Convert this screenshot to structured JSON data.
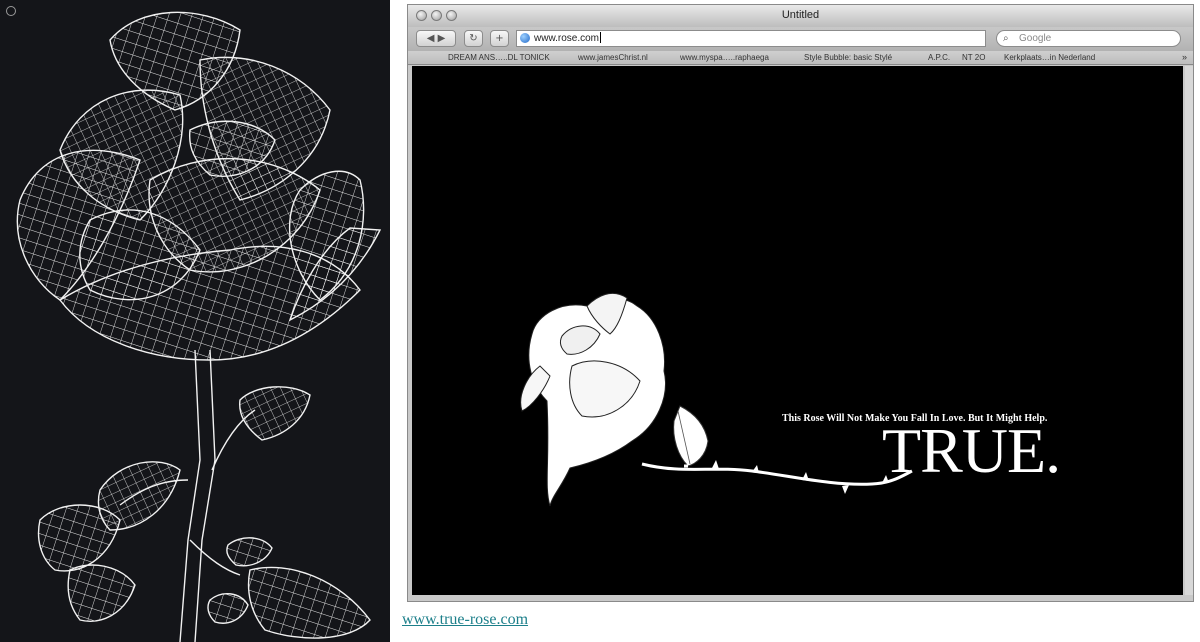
{
  "browser": {
    "window_title": "Untitled",
    "url": "www.rose.com",
    "search_placeholder": "Google",
    "bookmarks": [
      "\u0001\u0002",
      "DREAM ANS…..DL TONICK",
      "www.jamesChrist.nl",
      "www.myspa…..raphaega",
      "Style Bubble: basic Stylé",
      "A.P.C.",
      "NT 2O",
      "Kerkplaats…in Nederland"
    ]
  },
  "page": {
    "tagline": "This Rose Will Not Make You Fall In Love. But It Might Help.",
    "brand": "TRUE."
  },
  "caption": {
    "link_text": "www.true-rose.com"
  },
  "colors": {
    "left_panel_bg": "#141519",
    "viewport_bg": "#000000",
    "link": "#1c7f8a"
  }
}
